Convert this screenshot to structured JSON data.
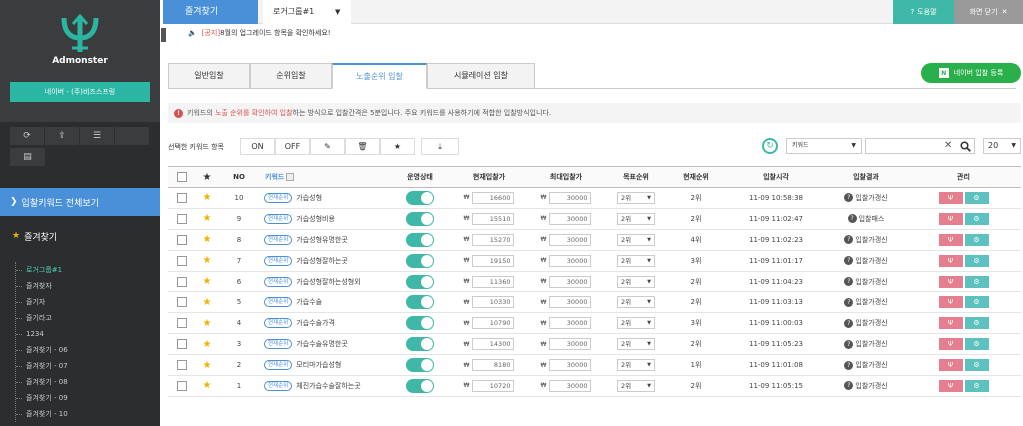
{
  "sidebar": {
    "logo_text": "Admonster",
    "account_label": "네이버 - (주)비즈스프링",
    "nav_all_label": "입찰키워드 전체보기",
    "nav_fav_label": "즐겨찾기",
    "groups": [
      "로거그룹#1",
      "즐겨찾자",
      "즐기자",
      "즐기라고",
      "1234",
      "즐겨찾기 - 06",
      "즐겨찾기 - 07",
      "즐겨찾기 - 08",
      "즐겨찾기 - 09",
      "즐겨찾기 - 10"
    ],
    "active_group_index": 0
  },
  "topbar": {
    "fav_tab": "즐겨찾기",
    "group_tab": "로거그룹#1",
    "help_label": "도움말",
    "close_label": "화면 닫기"
  },
  "notice": {
    "tag": "[공지]",
    "text": "8월의 업그레이드 항목을 확인하세요!"
  },
  "tabs": [
    "일반입찰",
    "순위입찰",
    "노출순위 입찰",
    "시뮬레이션 입찰"
  ],
  "active_tab_index": 2,
  "naver_btn": {
    "badge": "N",
    "label": "네이버 입찰 등록"
  },
  "info": {
    "pre": "키워드의",
    "highlight": "노출 순위를 확인하여 입찰",
    "post": "하는 방식으로 입찰간격은 5분입니다. 주요 키워드를 사용하기에 적합한 입찰방식입니다."
  },
  "actions": {
    "selected_label": "선택한 키워드 항목",
    "on_label": "ON",
    "off_label": "OFF",
    "search_field_select": "키워드",
    "page_size": "20"
  },
  "table": {
    "headers": {
      "no": "NO",
      "keyword": "키워드",
      "status": "운영상태",
      "current_bid": "현재입찰가",
      "max_bid": "최대입찰가",
      "target_rank": "목표순위",
      "current_rank": "현재순위",
      "bid_time": "입찰시각",
      "bid_result": "입찰결과",
      "manage": "관리"
    },
    "rank_tag": "현재순위",
    "won": "₩",
    "rows": [
      {
        "no": "10",
        "keyword": "가습성형",
        "current_bid": "16600",
        "max_bid": "30000",
        "target_rank": "2위",
        "current_rank": "2위",
        "time": "11-09 10:58:38",
        "result": "입찰가갱신"
      },
      {
        "no": "9",
        "keyword": "가습성형비용",
        "current_bid": "15510",
        "max_bid": "30000",
        "target_rank": "2위",
        "current_rank": "2위",
        "time": "11-09 11:02:47",
        "result": "입찰패스"
      },
      {
        "no": "8",
        "keyword": "가습성형유명한곳",
        "current_bid": "15270",
        "max_bid": "30000",
        "target_rank": "2위",
        "current_rank": "4위",
        "time": "11-09 11:02:23",
        "result": "입찰가갱신"
      },
      {
        "no": "7",
        "keyword": "가습성형잘하는곳",
        "current_bid": "19150",
        "max_bid": "30000",
        "target_rank": "2위",
        "current_rank": "3위",
        "time": "11-09 11:01:17",
        "result": "입찰가갱신"
      },
      {
        "no": "6",
        "keyword": "가습성형잘하는성형외",
        "current_bid": "11360",
        "max_bid": "30000",
        "target_rank": "2위",
        "current_rank": "2위",
        "time": "11-09 11:04:23",
        "result": "입찰가갱신"
      },
      {
        "no": "5",
        "keyword": "가습수술",
        "current_bid": "10330",
        "max_bid": "30000",
        "target_rank": "2위",
        "current_rank": "2위",
        "time": "11-09 11:03:13",
        "result": "입찰가갱신"
      },
      {
        "no": "4",
        "keyword": "가습수술가격",
        "current_bid": "10790",
        "max_bid": "30000",
        "target_rank": "2위",
        "current_rank": "3위",
        "time": "11-09 11:00:03",
        "result": "입찰가갱신"
      },
      {
        "no": "3",
        "keyword": "가습수술유명한곳",
        "current_bid": "14300",
        "max_bid": "30000",
        "target_rank": "2위",
        "current_rank": "2위",
        "time": "11-09 11:05:23",
        "result": "입찰가갱신"
      },
      {
        "no": "2",
        "keyword": "모티마가습성형",
        "current_bid": "8180",
        "max_bid": "30000",
        "target_rank": "2위",
        "current_rank": "1위",
        "time": "11-09 11:01:08",
        "result": "입찰가갱신"
      },
      {
        "no": "1",
        "keyword": "체진가습수술잘하는곳",
        "current_bid": "10720",
        "max_bid": "30000",
        "target_rank": "2위",
        "current_rank": "2위",
        "time": "11-09 11:05:15",
        "result": "입찰가갱신"
      }
    ]
  },
  "colors": {
    "accent_blue": "#4a90d9",
    "teal": "#3fb8a8",
    "naver_green": "#2ab04a",
    "warn_red": "#d9534f",
    "star": "#f0b400"
  }
}
